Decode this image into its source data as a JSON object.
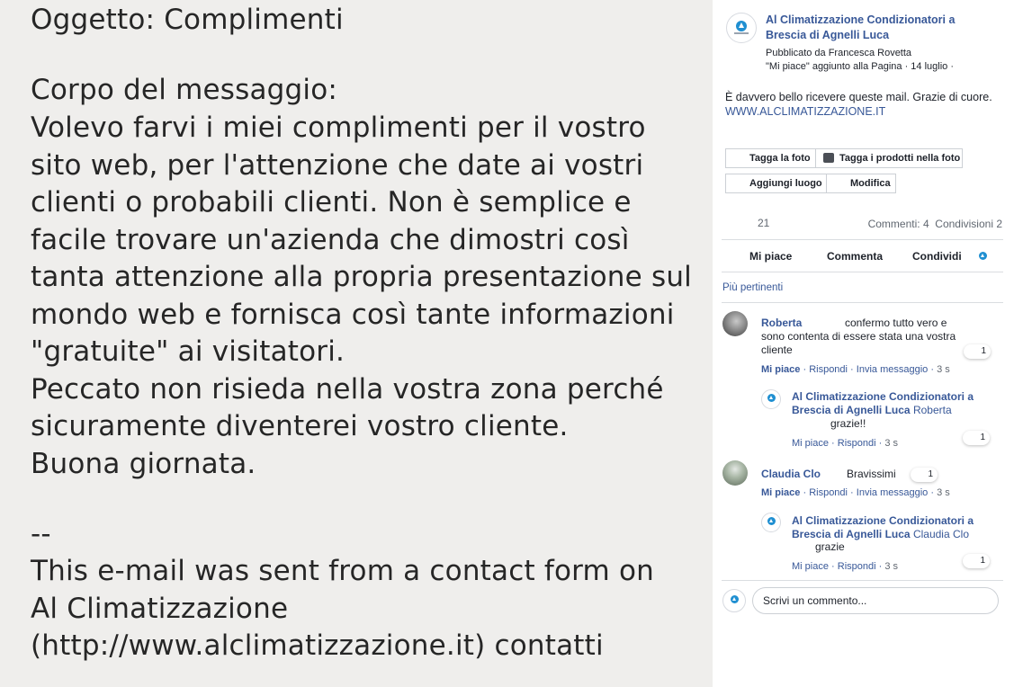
{
  "photo": {
    "lines": [
      "Oggetto: Complimenti",
      "Corpo del messaggio:",
      "Volevo farvi i miei complimenti per il vostro",
      "sito web, per l'attenzione che date ai vostri",
      "clienti o probabili clienti. Non è semplice e",
      "facile trovare un'azienda che dimostri così",
      "tanta attenzione alla propria presentazione sul",
      "mondo web e fornisca così tante informazioni",
      "\"gratuite\" ai visitatori.",
      "Peccato non risieda nella vostra zona perché",
      "sicuramente diventerei vostro cliente.",
      "Buona giornata.",
      "--",
      "This e-mail was sent from a contact form on",
      "Al Climatizzazione",
      "(http://www.alclimatizzazione.it) contatti"
    ]
  },
  "post": {
    "page_name_line1": "Al Climatizzazione Condizionatori a",
    "page_name_line2": "Brescia di Agnelli Luca",
    "published_by": "Pubblicato da Francesca Rovetta",
    "liked_added": "\"Mi piace\" aggiunto alla Pagina · 14 luglio ·",
    "text": "È davvero bello ricevere queste mail. Grazie di cuore.",
    "link": "WWW.ALCLIMATIZZAZIONE.IT"
  },
  "photo_actions": {
    "tag_photo": "Tagga la foto",
    "tag_products": "Tagga i prodotti nella foto",
    "add_place": "Aggiungi luogo",
    "edit": "Modifica"
  },
  "stats": {
    "reactions": "21",
    "comments_shares": "Commenti: 4  Condivisioni 2"
  },
  "actions": {
    "like": "Mi piace",
    "comment": "Commenta",
    "share": "Condividi"
  },
  "filter": "Più pertinenti",
  "comments": [
    {
      "author": "Roberta",
      "text_line1": "confermo tutto vero e",
      "text_line2": "sono contenta di essere stata una vostra",
      "text_line3": "cliente",
      "like": "Mi piace",
      "reply": "Rispondi",
      "message": "Invia messaggio",
      "time": "3 s",
      "reactions": "1",
      "reply_item": {
        "author_line1": "Al Climatizzazione Condizionatori a",
        "author_line2": "Brescia di Agnelli Luca",
        "mention": "Roberta",
        "text": "grazie!!",
        "like": "Mi piace",
        "reply": "Rispondi",
        "time": "3 s",
        "reactions": "1"
      }
    },
    {
      "author": "Claudia Clo",
      "text_line1": "Bravissimi",
      "like": "Mi piace",
      "reply": "Rispondi",
      "message": "Invia messaggio",
      "time": "3 s",
      "reactions": "1",
      "reply_item": {
        "author_line1": "Al Climatizzazione Condizionatori a",
        "author_line2": "Brescia di Agnelli Luca",
        "mention": "Claudia Clo",
        "text": "grazie",
        "like": "Mi piace",
        "reply": "Rispondi",
        "time": "3 s",
        "reactions": "1"
      }
    }
  ],
  "composer": {
    "placeholder": "Scrivi un commento..."
  },
  "colors": {
    "link": "#385898",
    "brand_mark": "#1f8fd1",
    "photo_bg": "#efeeec"
  }
}
